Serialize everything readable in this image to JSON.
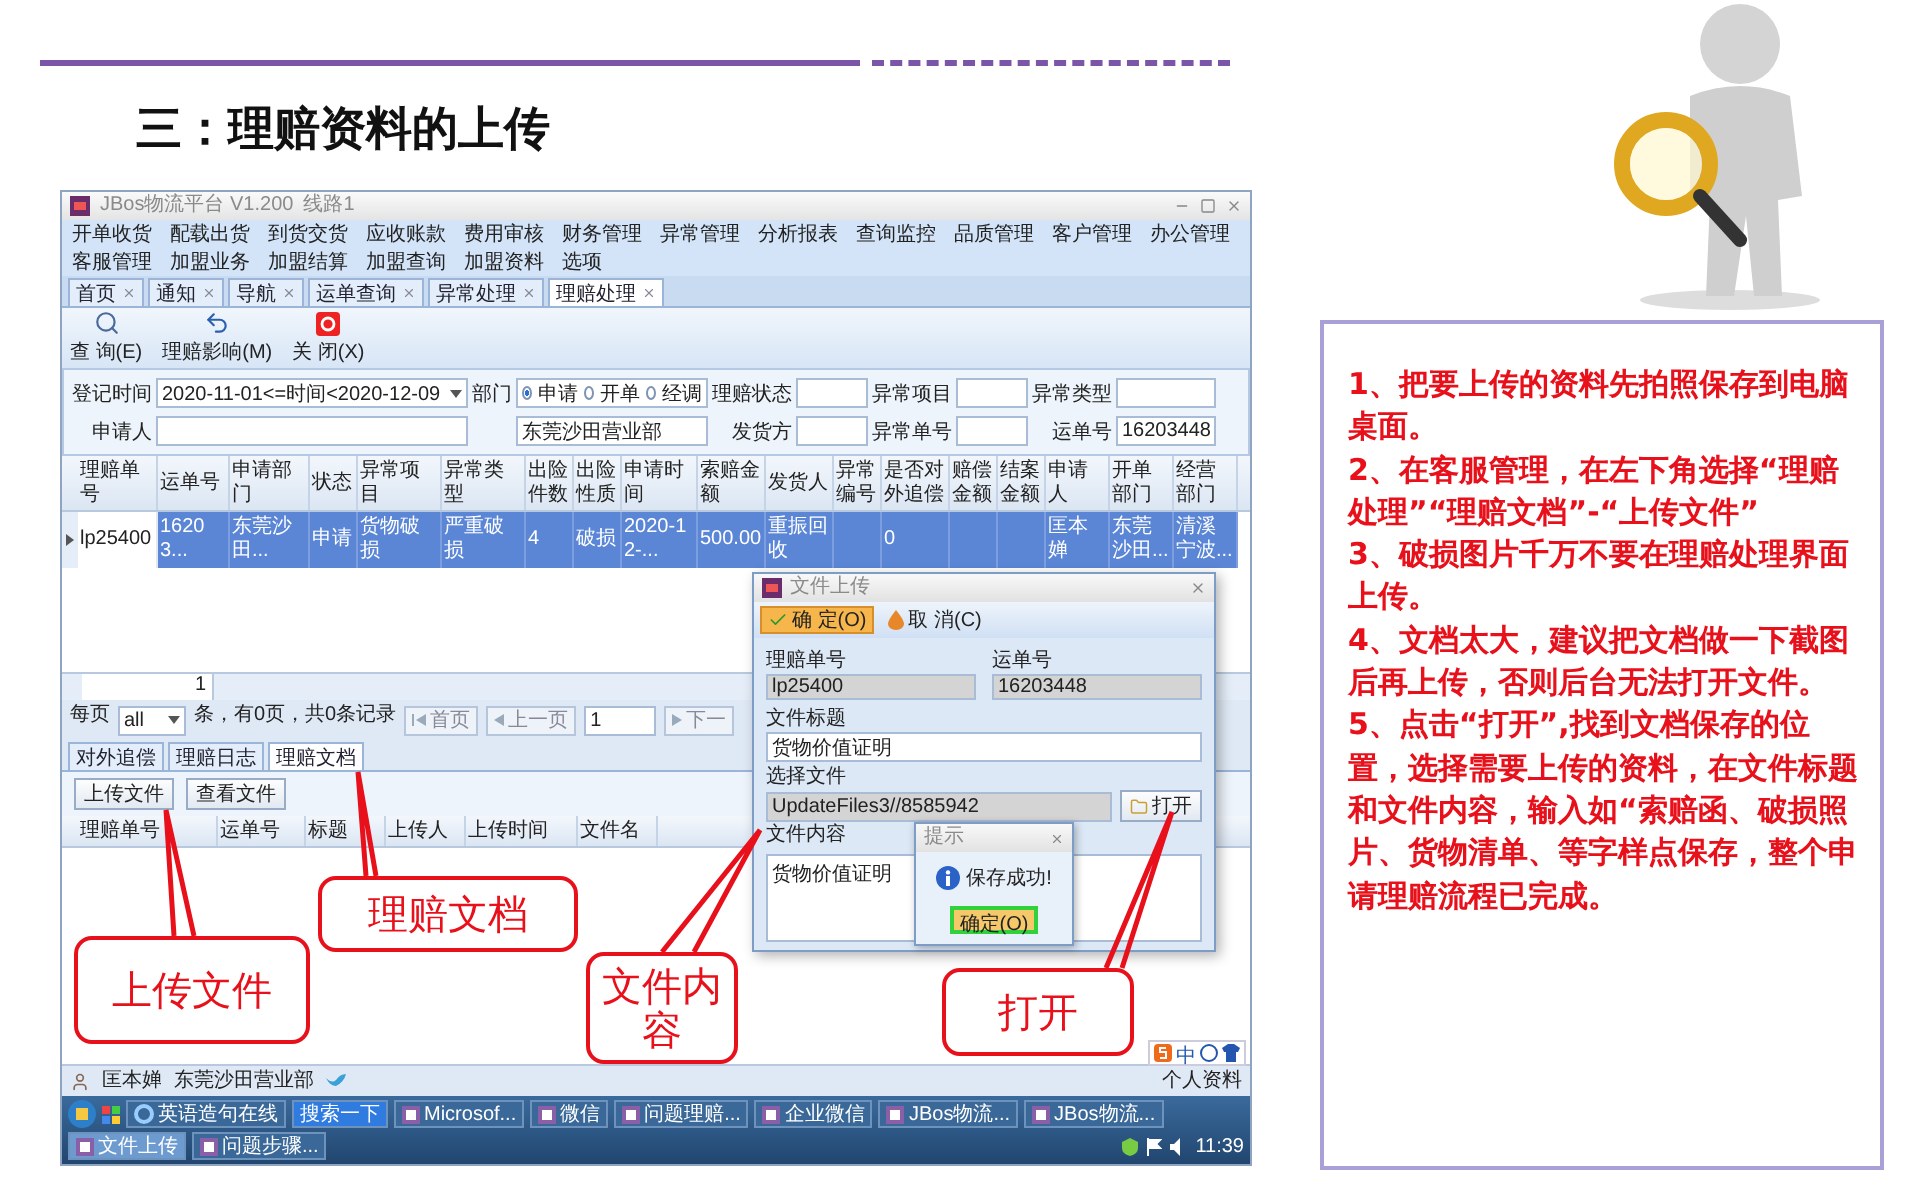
{
  "slide": {
    "title": "三：理赔资料的上传"
  },
  "app": {
    "window_title": "JBos物流平台 V1.200",
    "line": "线路1",
    "menu": [
      "开单收货",
      "配载出货",
      "到货交货",
      "应收账款",
      "费用审核",
      "财务管理",
      "异常管理",
      "分析报表",
      "查询监控",
      "品质管理",
      "客户管理",
      "办公管理",
      "客服管理",
      "加盟业务",
      "加盟结算",
      "加盟查询",
      "加盟资料",
      "选项"
    ],
    "tabs": [
      {
        "label": "首页",
        "selected": false
      },
      {
        "label": "通知",
        "selected": false
      },
      {
        "label": "导航",
        "selected": false
      },
      {
        "label": "运单查询",
        "selected": false
      },
      {
        "label": "异常处理",
        "selected": false
      },
      {
        "label": "理赔处理",
        "selected": true
      }
    ],
    "toolbar": [
      {
        "kind": "search",
        "label": "查 询(E)"
      },
      {
        "kind": "undo",
        "label": "理赔影响(M)"
      },
      {
        "kind": "close",
        "label": "关 闭(X)"
      }
    ],
    "filter_rows": [
      [
        {
          "kind": "field",
          "label": "登记时间",
          "value": "2020-11-01<=时间<2020-12-09",
          "dropdown": true
        },
        {
          "kind": "radio",
          "label": "部门",
          "options": [
            {
              "label": "申请",
              "selected": true
            },
            {
              "label": "开单",
              "selected": false
            },
            {
              "label": "经调",
              "selected": false
            }
          ]
        },
        {
          "kind": "field",
          "label": "理赔状态"
        },
        {
          "kind": "field",
          "label": "异常项目"
        },
        {
          "kind": "field",
          "label": "异常类型"
        }
      ],
      [
        {
          "kind": "field",
          "label": "申请人"
        },
        {
          "kind": "box",
          "value": "东莞沙田营业部"
        },
        {
          "kind": "field",
          "label": "发货方"
        },
        {
          "kind": "field",
          "label": "异常单号"
        },
        {
          "kind": "field",
          "label": "运单号",
          "value": "16203448"
        }
      ]
    ],
    "claims_table": {
      "columns": [
        "理赔单号",
        "运单号",
        "申请部门",
        "状态",
        "异常项目",
        "异常类型",
        "出险件数",
        "出险性质",
        "申请时间",
        "索赔金额",
        "发货人",
        "异常编号",
        "是否对外追偿",
        "赔偿金额",
        "结案金额",
        "申请人",
        "开单部门",
        "经营部门"
      ],
      "rows": [
        {
          "selected": true,
          "cells": [
            "lp25400",
            "16203...",
            "东莞沙田...",
            "申请",
            "货物破损",
            "严重破损",
            "4",
            "破损",
            "2020-12-...",
            "500.00",
            "重振回收",
            "",
            "0",
            "",
            "",
            "匡本婵",
            "东莞沙田...",
            "清溪宁波..."
          ]
        }
      ],
      "footer": "1"
    },
    "pagination": {
      "per_page_label": "每页",
      "per_page": "all",
      "summary": "条，有0页，共0条记录",
      "first": "首页",
      "prev": "上一页",
      "page": "1",
      "next": "下一"
    },
    "detail_tabs": [
      {
        "label": "对外追偿",
        "selected": false
      },
      {
        "label": "理赔日志",
        "selected": false
      },
      {
        "label": "理赔文档",
        "selected": true
      }
    ],
    "detail_buttons": [
      "上传文件",
      "查看文件"
    ],
    "detail_columns": [
      "理赔单号",
      "运单号",
      "标题",
      "上传人",
      "上传时间",
      "文件名"
    ],
    "ime": "中",
    "status": {
      "user": "匡本婵",
      "dept": "东莞沙田营业部",
      "link": "个人资料"
    },
    "taskbar": {
      "items": [
        {
          "kind": "browser",
          "label": "英语造句在线",
          "selected": false
        },
        {
          "kind": "plain",
          "label": "搜索一下",
          "selected": false
        },
        {
          "kind": "app",
          "label": "Microsof...",
          "selected": false
        },
        {
          "kind": "app",
          "label": "微信",
          "selected": false
        },
        {
          "kind": "app",
          "label": "问题理赔...",
          "selected": false
        },
        {
          "kind": "app",
          "label": "企业微信",
          "selected": false
        },
        {
          "kind": "app",
          "label": "JBos物流...",
          "selected": false
        },
        {
          "kind": "app",
          "label": "JBos物流...",
          "selected": false
        },
        {
          "kind": "app",
          "label": "文件上传",
          "selected": true
        },
        {
          "kind": "app",
          "label": "问题步骤...",
          "selected": false
        }
      ],
      "time": "11:39"
    }
  },
  "dialog": {
    "title": "文件上传",
    "ok": "确 定(O)",
    "cancel": "取 消(C)",
    "fields": [
      {
        "label": "理赔单号",
        "value": "lp25400",
        "disabled": true
      },
      {
        "label": "运单号",
        "value": "16203448",
        "disabled": true
      },
      {
        "label": "文件标题",
        "value": "货物价值证明",
        "disabled": false
      },
      {
        "label": "选择文件",
        "value": "UpdateFiles3//8585942",
        "disabled": true
      }
    ],
    "open_button": "打开",
    "content_label": "文件内容",
    "content": "货物价值证明"
  },
  "prompt": {
    "title": "提示",
    "message": "保存成功!",
    "button": "确定(O)"
  },
  "callouts": [
    {
      "text": "上传文件"
    },
    {
      "text": "理赔文档"
    },
    {
      "text": "文件内容"
    },
    {
      "text": "打开"
    }
  ],
  "notes": [
    "1、把要上传的资料先拍照保存到电脑桌面。",
    "2、在客服管理，在左下角选择“理赔处理”“理赔文档”-“上传文件”",
    "3、破损图片千万不要在理赔处理界面上传。",
    "4、文档太大，建议把文档做一下截图后再上传，否则后台无法打开文件。",
    "5、点击“打开”,找到文档保存的位置，选择需要上传的资料，在文件标题和文件内容，输入如“索赔函、破损照片、货物清单、等字样点保存，整个申请理赔流程已完成。"
  ]
}
